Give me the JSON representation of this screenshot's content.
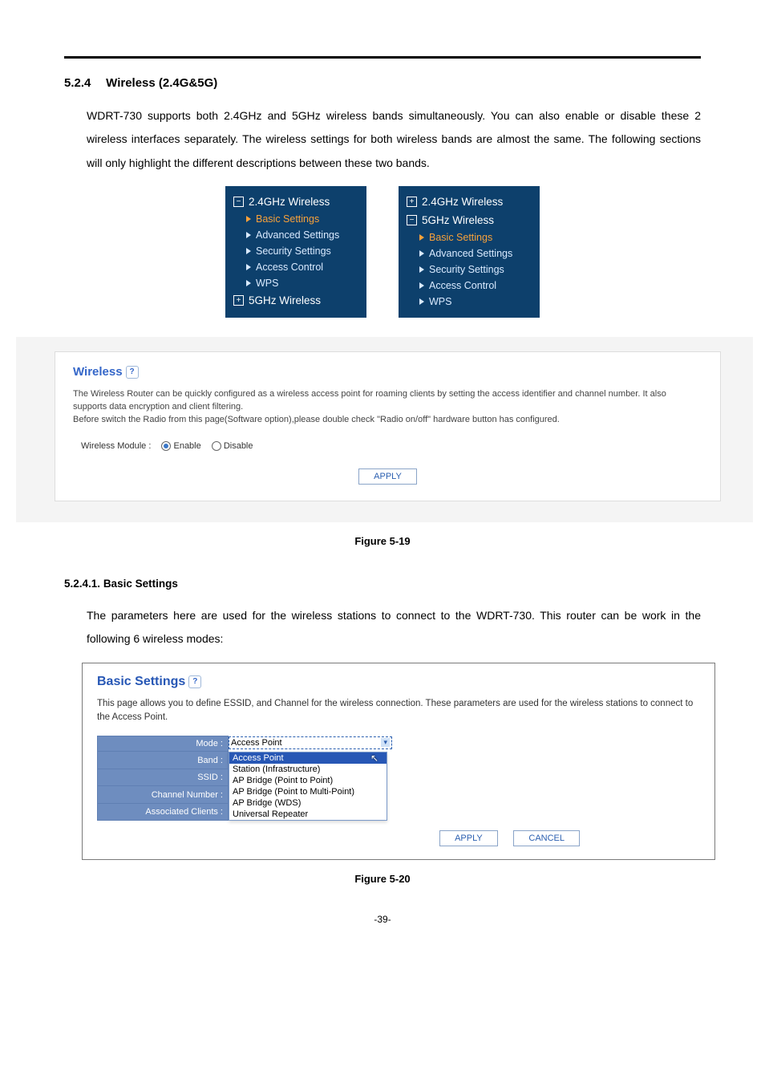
{
  "section": {
    "num": "5.2.4",
    "title": "Wireless (2.4G&5G)"
  },
  "intro": "WDRT-730 supports both 2.4GHz and 5GHz wireless bands simultaneously. You can also enable or disable these 2 wireless interfaces separately. The wireless settings for both wireless bands are almost the same. The following sections will only highlight the different descriptions between these two bands.",
  "navL": {
    "g1": "2.4GHz Wireless",
    "s1": "Basic Settings",
    "s2": "Advanced Settings",
    "s3": "Security Settings",
    "s4": "Access Control",
    "s5": "WPS",
    "g2": "5GHz Wireless"
  },
  "navR": {
    "g1": "2.4GHz Wireless",
    "g2": "5GHz Wireless",
    "s1": "Basic Settings",
    "s2": "Advanced Settings",
    "s3": "Security Settings",
    "s4": "Access Control",
    "s5": "WPS"
  },
  "panel1": {
    "title": "Wireless",
    "desc1": "The Wireless Router can be quickly configured as a wireless access point for roaming clients by setting the access identifier and channel number. It also supports data encryption and client filtering.",
    "desc2": "Before switch the Radio from this page(Software option),please double check \"Radio on/off\" hardware button has configured.",
    "module_label": "Wireless Module :",
    "enable": "Enable",
    "disable": "Disable",
    "apply": "APPLY"
  },
  "fig19": "Figure 5-19",
  "sub": {
    "num": "5.2.4.1.",
    "title": "Basic Settings"
  },
  "intro2": "The parameters here are used for the wireless stations to connect to the WDRT-730. This router can be work in the following 6 wireless modes:",
  "panel2": {
    "title": "Basic Settings",
    "desc": "This page allows you to define ESSID, and Channel for the wireless connection. These parameters are used for the wireless stations to connect to the Access Point.",
    "labels": {
      "mode": "Mode :",
      "band": "Band :",
      "ssid": "SSID :",
      "chan": "Channel Number :",
      "clients": "Associated Clients :"
    },
    "mode_value": "Access Point",
    "opts": {
      "o1": "Access Point",
      "o2": "Station (Infrastructure)",
      "o3": "AP Bridge (Point to Point)",
      "o4": "AP Bridge (Point to Multi-Point)",
      "o5": "AP Bridge (WDS)",
      "o6": "Universal Repeater"
    },
    "apply": "APPLY",
    "cancel": "CANCEL"
  },
  "fig20": "Figure 5-20",
  "pagenum": "-39-"
}
